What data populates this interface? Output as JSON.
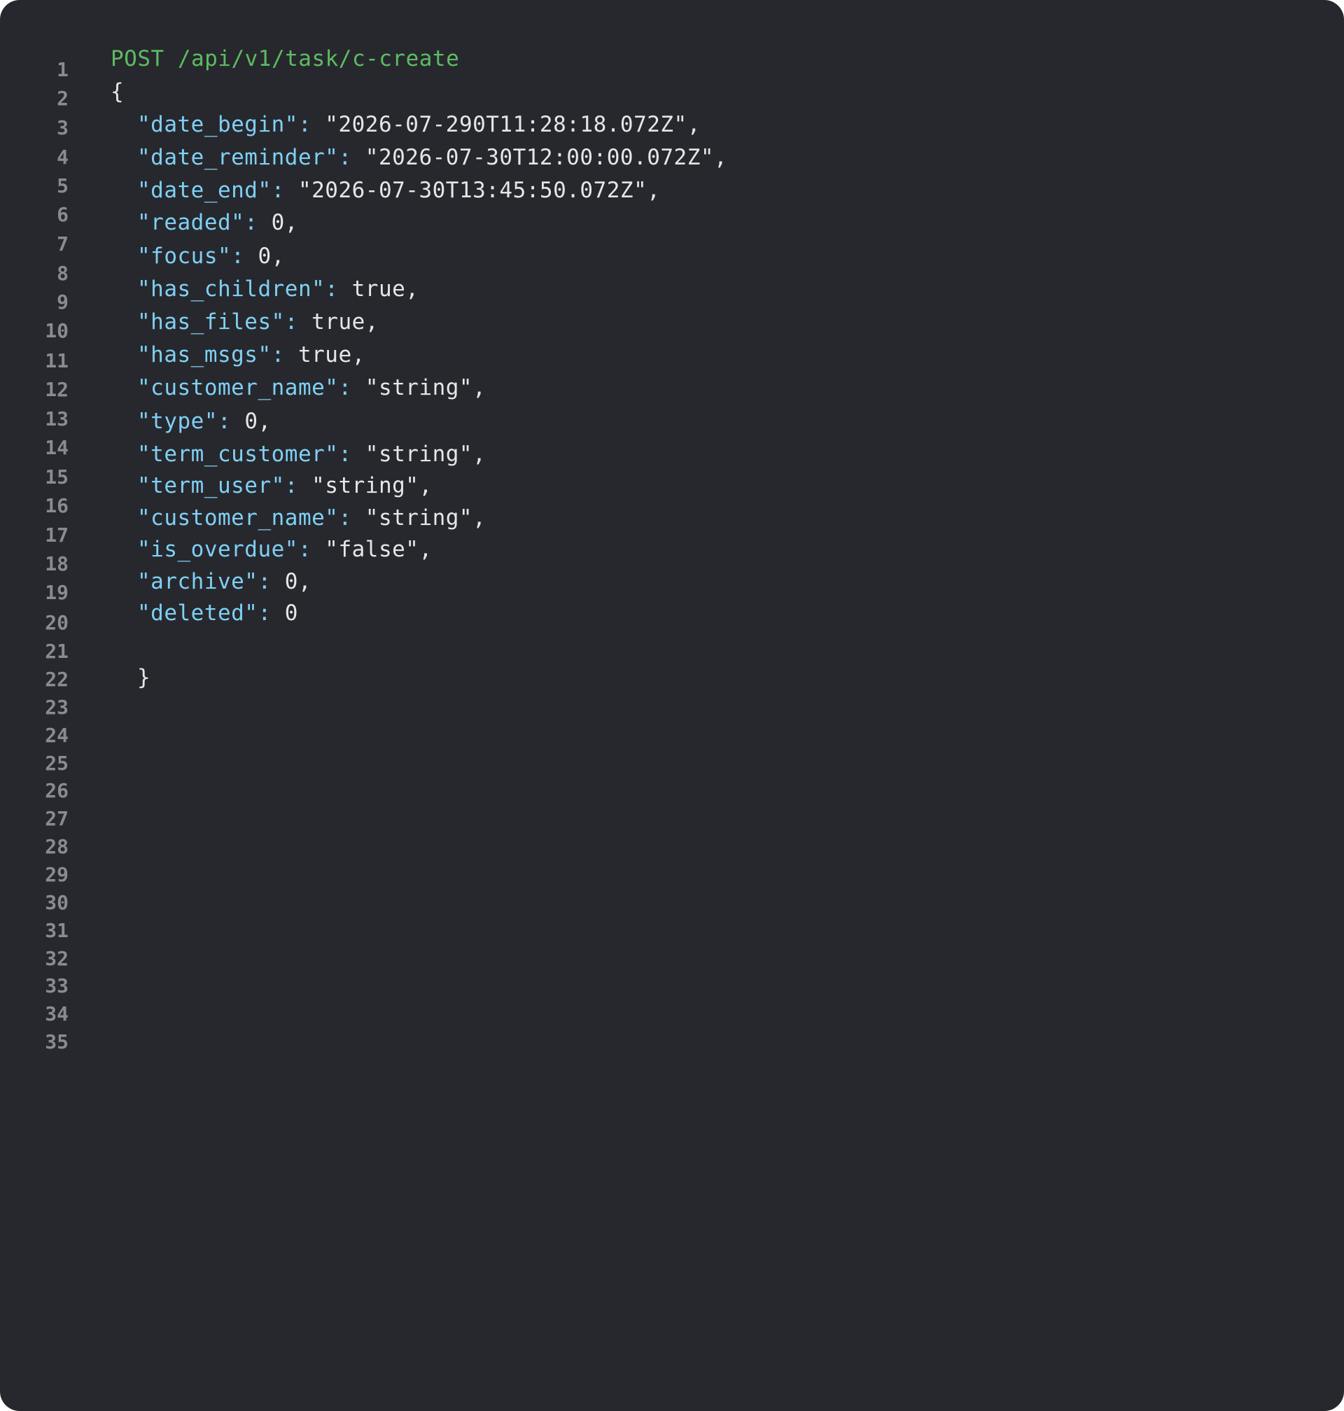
{
  "editor": {
    "line_numbers": [
      "1",
      "2",
      "3",
      "4",
      "5",
      "6",
      "7",
      "8",
      "9",
      "10",
      "11",
      "12",
      "13",
      "14",
      "15",
      "16",
      "17",
      "18",
      "19",
      "20",
      "21",
      "22",
      "23",
      "24",
      "25",
      "26",
      "27",
      "28",
      "29",
      "30",
      "31",
      "32",
      "33",
      "34",
      "35"
    ],
    "request_line": "POST /api/v1/task/c-create",
    "open_brace": "{",
    "close_brace": "}",
    "fields": [
      {
        "key": "\"date_begin\":",
        "value": " \"2026-07-290T11:28:18.072Z\","
      },
      {
        "key": "\"date_reminder\":",
        "value": " \"2026-07-30T12:00:00.072Z\","
      },
      {
        "key": "\"date_end\":",
        "value": " \"2026-07-30T13:45:50.072Z\","
      },
      {
        "key": "\"readed\":",
        "value": " 0,"
      },
      {
        "key": "\"focus\":",
        "value": " 0,"
      },
      {
        "key": "\"has_children\":",
        "value": " true,"
      },
      {
        "key": "\"has_files\":",
        "value": " true,"
      },
      {
        "key": "\"has_msgs\":",
        "value": " true,"
      },
      {
        "key": "\"customer_name\":",
        "value": " \"string\","
      },
      {
        "key": "\"type\":",
        "value": " 0,"
      },
      {
        "key": "\"term_customer\":",
        "value": " \"string\","
      },
      {
        "key": "\"term_user\":",
        "value": " \"string\","
      },
      {
        "key": "\"customer_name\":",
        "value": " \"string\","
      },
      {
        "key": "\"is_overdue\":",
        "value": " \"false\","
      },
      {
        "key": "\"archive\":",
        "value": " 0,"
      },
      {
        "key": "\"deleted\":",
        "value": " 0"
      }
    ],
    "colors": {
      "background": "#27282d",
      "method": "#5dbb63",
      "key": "#7fd0f5",
      "value": "#e6e6e6",
      "line_number": "#8a8b90"
    }
  }
}
